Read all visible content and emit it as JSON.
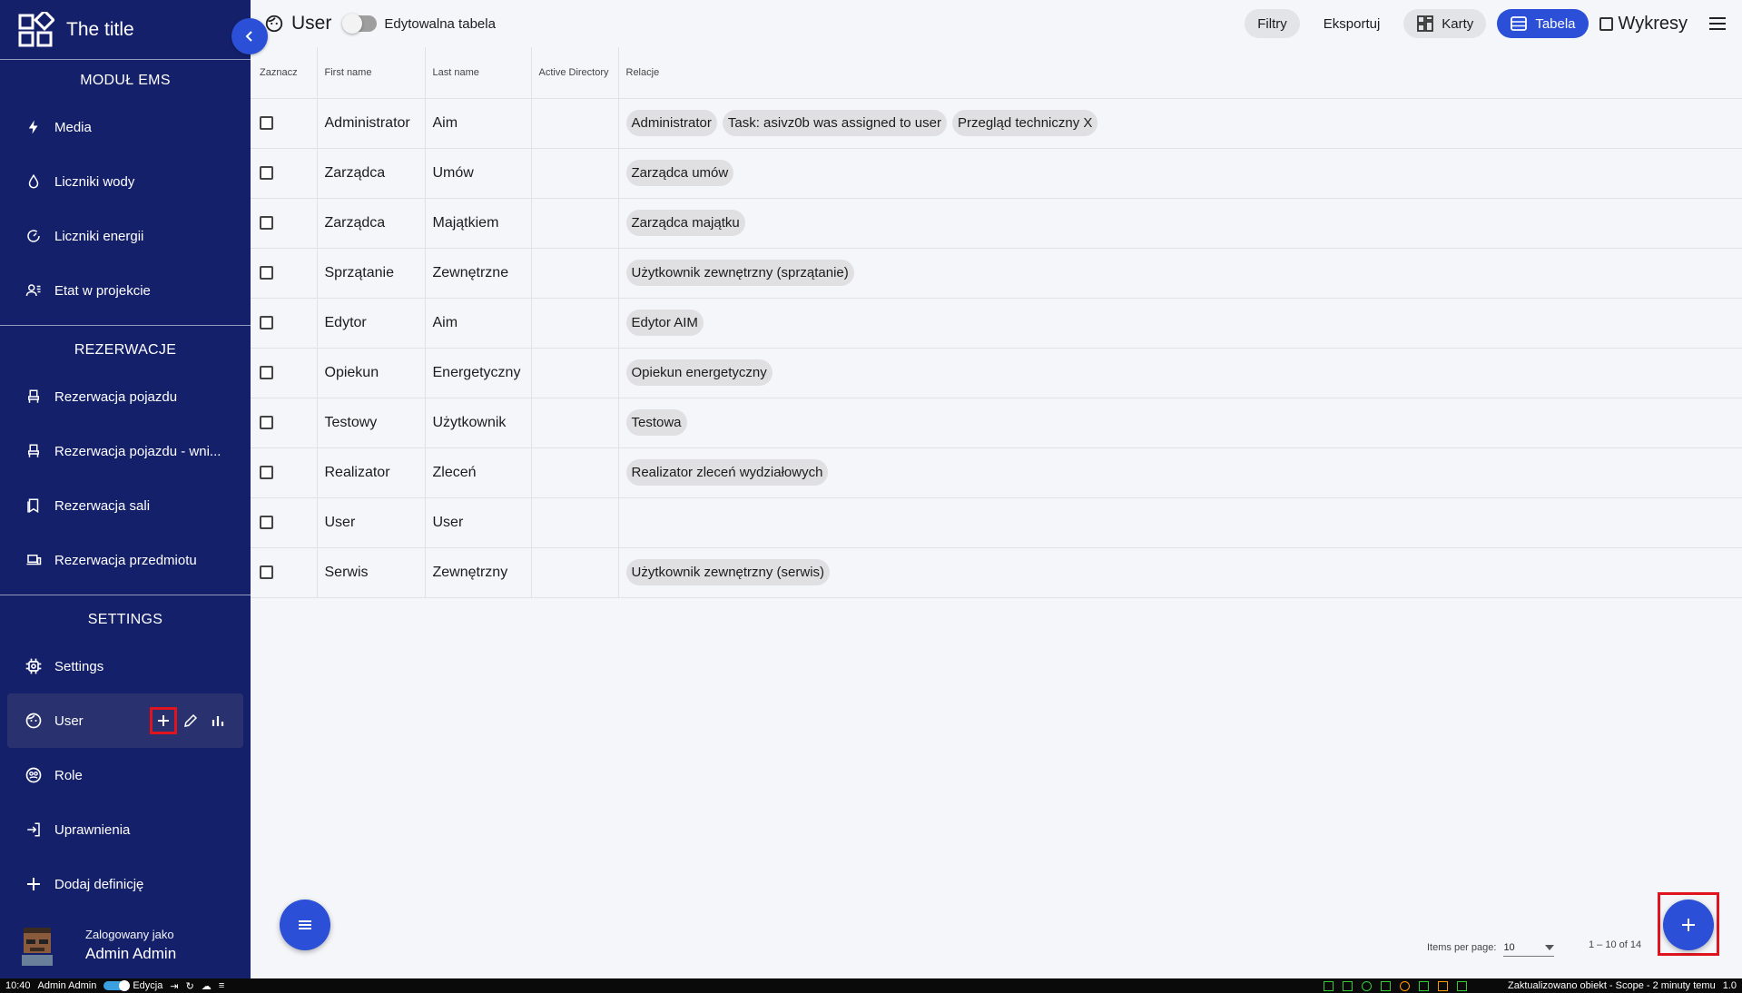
{
  "app": {
    "title": "The title"
  },
  "sidebar": {
    "sections": [
      {
        "title": "MODUŁ EMS",
        "items": [
          {
            "label": "Media",
            "icon": "bolt-icon"
          },
          {
            "label": "Liczniki wody",
            "icon": "water-drop-icon"
          },
          {
            "label": "Liczniki energii",
            "icon": "energy-meter-icon"
          },
          {
            "label": "Etat w projekcie",
            "icon": "person-work-icon"
          }
        ]
      },
      {
        "title": "REZERWACJE",
        "items": [
          {
            "label": "Rezerwacja pojazdu",
            "icon": "seat-icon"
          },
          {
            "label": "Rezerwacja pojazdu - wni...",
            "icon": "seat-icon"
          },
          {
            "label": "Rezerwacja sali",
            "icon": "bookmark-icon"
          },
          {
            "label": "Rezerwacja przedmiotu",
            "icon": "devices-icon"
          }
        ]
      },
      {
        "title": "SETTINGS",
        "items": [
          {
            "label": "Settings",
            "icon": "gear-chip-icon"
          },
          {
            "label": "User",
            "icon": "face-icon",
            "active": true
          },
          {
            "label": "Role",
            "icon": "face-group-icon"
          },
          {
            "label": "Uprawnienia",
            "icon": "login-icon"
          },
          {
            "label": "Dodaj definicję",
            "icon": "plus-icon"
          }
        ]
      }
    ],
    "user": {
      "logged_as": "Zalogowany jako",
      "name": "Admin Admin"
    }
  },
  "topbar": {
    "title": "User",
    "toggle_label": "Edytowalna tabela",
    "filters": "Filtry",
    "export": "Eksportuj",
    "cards": "Karty",
    "table": "Tabela",
    "charts": "Wykresy"
  },
  "table": {
    "columns": [
      "Zaznacz",
      "First name",
      "Last name",
      "Active Directory",
      "Relacje"
    ],
    "rows": [
      {
        "first": "Administrator",
        "last": "Aim",
        "ad": "",
        "relations": [
          "Administrator",
          "Task: asivz0b was assigned to user",
          "Przegląd techniczny X"
        ]
      },
      {
        "first": "Zarządca",
        "last": "Umów",
        "ad": "",
        "relations": [
          "Zarządca umów"
        ]
      },
      {
        "first": "Zarządca",
        "last": "Majątkiem",
        "ad": "",
        "relations": [
          "Zarządca majątku"
        ]
      },
      {
        "first": "Sprzątanie",
        "last": "Zewnętrzne",
        "ad": "",
        "relations": [
          "Użytkownik zewnętrzny (sprzątanie)"
        ]
      },
      {
        "first": "Edytor",
        "last": "Aim",
        "ad": "",
        "relations": [
          "Edytor AIM"
        ]
      },
      {
        "first": "Opiekun",
        "last": "Energetyczny",
        "ad": "",
        "relations": [
          "Opiekun energetyczny"
        ]
      },
      {
        "first": "Testowy",
        "last": "Użytkownik",
        "ad": "",
        "relations": [
          "Testowa"
        ]
      },
      {
        "first": "Realizator",
        "last": "Zleceń",
        "ad": "",
        "relations": [
          "Realizator zleceń wydziałowych"
        ]
      },
      {
        "first": "User",
        "last": "User",
        "ad": "",
        "relations": []
      },
      {
        "first": "Serwis",
        "last": "Zewnętrzny",
        "ad": "",
        "relations": [
          "Użytkownik zewnętrzny (serwis)"
        ]
      }
    ]
  },
  "pager": {
    "items_label": "Items per page:",
    "items_value": "10",
    "range": "1 – 10 of 14"
  },
  "statusbar": {
    "time": "10:40",
    "user": "Admin Admin",
    "mode": "Edycja",
    "message": "Zaktualizowano obiekt - Scope - 2 minuty temu",
    "version": "1.0"
  },
  "colors": {
    "sidebar": "#15206b",
    "accent": "#2b4fd6",
    "highlight": "#e0141e"
  }
}
